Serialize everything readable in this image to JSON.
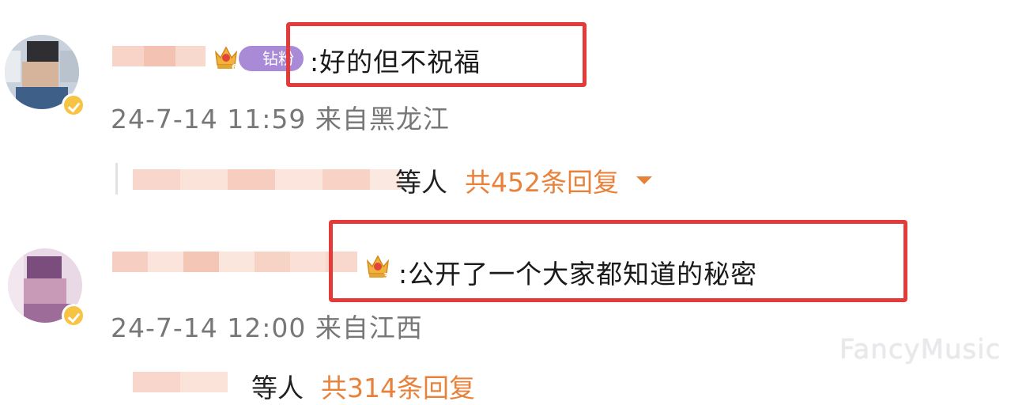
{
  "comments": [
    {
      "badge_label": "钻粉",
      "badge_level": "6",
      "text": ":好的但不祝福",
      "timestamp": "24-7-14 11:59 来自黑龙江",
      "replies": {
        "people_suffix": "等人",
        "count_label": "共452条回复"
      }
    },
    {
      "badge_level": "3",
      "text": ":公开了一个大家都知道的秘密",
      "timestamp": "24-7-14 12:00 来自江西",
      "replies": {
        "people_suffix": "等人",
        "count_label": "共314条回复"
      }
    }
  ],
  "watermark": "FancyMusic",
  "colors": {
    "highlight_box": "#e53a3a",
    "reply_count": "#e8823b",
    "fan_badge": "#a98ad6",
    "verified": "#f6c343"
  }
}
